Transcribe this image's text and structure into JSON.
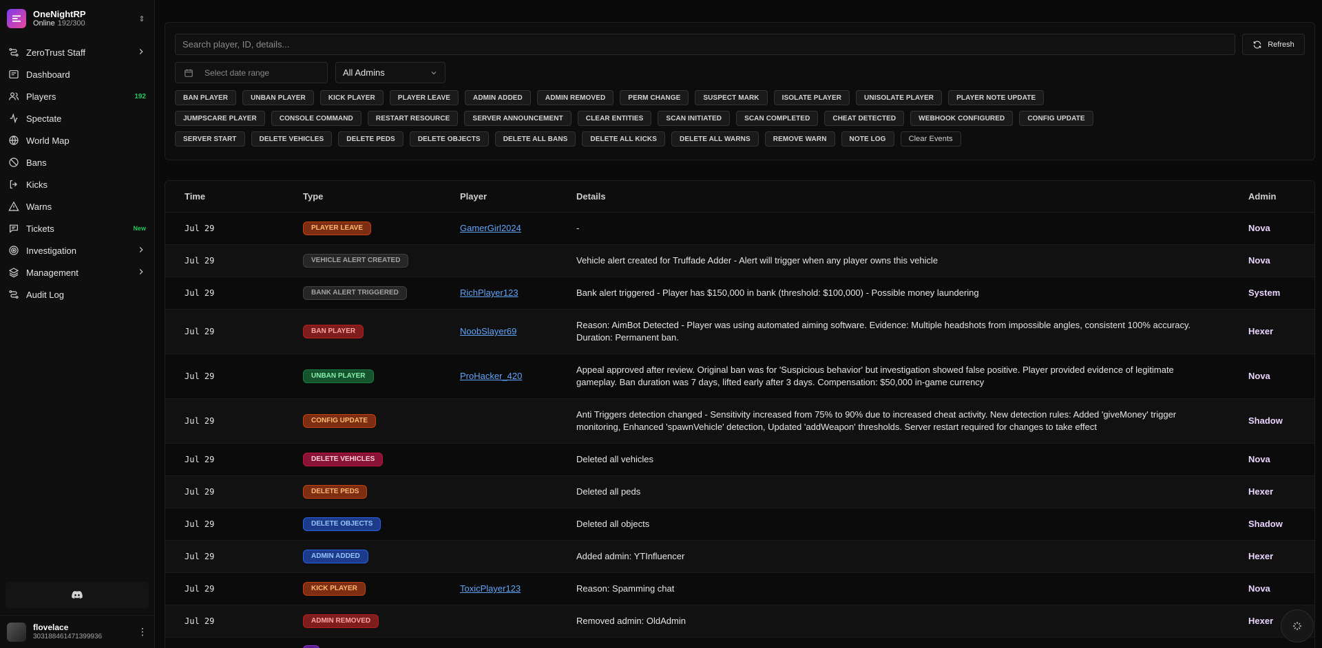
{
  "brand": {
    "name": "OneNightRP",
    "status": "Online",
    "count": "192/300"
  },
  "nav": [
    {
      "label": "ZeroTrust Staff",
      "icon": "zerotrust-icon",
      "chevron": true
    },
    {
      "label": "Dashboard",
      "icon": "dashboard-icon"
    },
    {
      "label": "Players",
      "icon": "players-icon",
      "badge": "192"
    },
    {
      "label": "Spectate",
      "icon": "spectate-icon"
    },
    {
      "label": "World Map",
      "icon": "globe-icon"
    },
    {
      "label": "Bans",
      "icon": "ban-icon"
    },
    {
      "label": "Kicks",
      "icon": "kick-icon"
    },
    {
      "label": "Warns",
      "icon": "warning-icon"
    },
    {
      "label": "Tickets",
      "icon": "ticket-icon",
      "new": "New"
    },
    {
      "label": "Investigation",
      "icon": "investigation-icon",
      "chevron": true
    },
    {
      "label": "Management",
      "icon": "layers-icon",
      "chevron": true
    },
    {
      "label": "Audit Log",
      "icon": "audit-icon"
    }
  ],
  "user": {
    "name": "flovelace",
    "id": "303188461471399936"
  },
  "search": {
    "placeholder": "Search player, ID, details..."
  },
  "refresh_label": "Refresh",
  "date_placeholder": "Select date range",
  "admin_filter": "All Admins",
  "event_filters": [
    "BAN PLAYER",
    "UNBAN PLAYER",
    "KICK PLAYER",
    "PLAYER LEAVE",
    "ADMIN ADDED",
    "ADMIN REMOVED",
    "PERM CHANGE",
    "SUSPECT MARK",
    "ISOLATE PLAYER",
    "UNISOLATE PLAYER",
    "PLAYER NOTE UPDATE",
    "JUMPSCARE PLAYER",
    "CONSOLE COMMAND",
    "RESTART RESOURCE",
    "SERVER ANNOUNCEMENT",
    "CLEAR ENTITIES",
    "SCAN INITIATED",
    "SCAN COMPLETED",
    "CHEAT DETECTED",
    "WEBHOOK CONFIGURED",
    "CONFIG UPDATE",
    "SERVER START",
    "DELETE VEHICLES",
    "DELETE PEDS",
    "DELETE OBJECTS",
    "DELETE ALL BANS",
    "DELETE ALL KICKS",
    "DELETE ALL WARNS",
    "REMOVE WARN",
    "NOTE LOG"
  ],
  "clear_events_label": "Clear Events",
  "table": {
    "headers": {
      "time": "Time",
      "type": "Type",
      "player": "Player",
      "details": "Details",
      "admin": "Admin"
    },
    "rows": [
      {
        "time": "Jul 29",
        "type": "PLAYER LEAVE",
        "color": "orange",
        "player": "GamerGirl2024",
        "details": "-",
        "admin": "Nova",
        "h": 47
      },
      {
        "time": "Jul 29",
        "type": "VEHICLE ALERT CREATED",
        "color": "gray",
        "player": "",
        "details": "Vehicle alert created for Truffade Adder - Alert will trigger when any player owns this vehicle",
        "admin": "Nova",
        "h": 47
      },
      {
        "time": "Jul 29",
        "type": "BANK ALERT TRIGGERED",
        "color": "gray",
        "player": "RichPlayer123",
        "details": "Bank alert triggered - Player has $150,000 in bank (threshold: $100,000) - Possible money laundering",
        "admin": "System",
        "h": 47
      },
      {
        "time": "Jul 29",
        "type": "BAN PLAYER",
        "color": "red",
        "player": "NoobSlayer69",
        "details": "Reason: AimBot Detected - Player was using automated aiming software. Evidence: Multiple headshots from impossible angles, consistent 100% accuracy. Duration: Permanent ban.",
        "admin": "Hexer",
        "h": 65
      },
      {
        "time": "Jul 29",
        "type": "UNBAN PLAYER",
        "color": "green",
        "player": "ProHacker_420",
        "details": "Appeal approved after review. Original ban was for 'Suspicious behavior' but investigation showed false positive. Player provided evidence of legitimate gameplay. Ban duration was 7 days, lifted early after 3 days. Compensation: $50,000 in-game currency",
        "admin": "Nova",
        "h": 65
      },
      {
        "time": "Jul 29",
        "type": "CONFIG UPDATE",
        "color": "orange",
        "player": "",
        "details": "Anti Triggers detection changed - Sensitivity increased from 75% to 90% due to increased cheat activity. New detection rules: Added 'giveMoney' trigger monitoring, Enhanced 'spawnVehicle' detection, Updated 'addWeapon' thresholds. Server restart required for changes to take effect",
        "admin": "Shadow",
        "h": 65
      },
      {
        "time": "Jul 29",
        "type": "DELETE VEHICLES",
        "color": "crimson",
        "player": "",
        "details": "Deleted all vehicles",
        "admin": "Nova",
        "h": 47
      },
      {
        "time": "Jul 29",
        "type": "DELETE PEDS",
        "color": "orange",
        "player": "",
        "details": "Deleted all peds",
        "admin": "Hexer",
        "h": 47
      },
      {
        "time": "Jul 29",
        "type": "DELETE OBJECTS",
        "color": "blue",
        "player": "",
        "details": "Deleted all objects",
        "admin": "Shadow",
        "h": 47
      },
      {
        "time": "Jul 29",
        "type": "ADMIN ADDED",
        "color": "blue",
        "player": "",
        "details": "Added admin: YTInfluencer",
        "admin": "Hexer",
        "h": 47
      },
      {
        "time": "Jul 29",
        "type": "KICK PLAYER",
        "color": "orange",
        "player": "ToxicPlayer123",
        "details": "Reason: Spamming chat",
        "admin": "Nova",
        "h": 47
      },
      {
        "time": "Jul 29",
        "type": "ADMIN REMOVED",
        "color": "red",
        "player": "",
        "details": "Removed admin: OldAdmin",
        "admin": "Hexer",
        "h": 47
      },
      {
        "time": "",
        "type": "",
        "color": "purple",
        "player": "",
        "details": "",
        "admin": "",
        "h": 47
      }
    ]
  }
}
